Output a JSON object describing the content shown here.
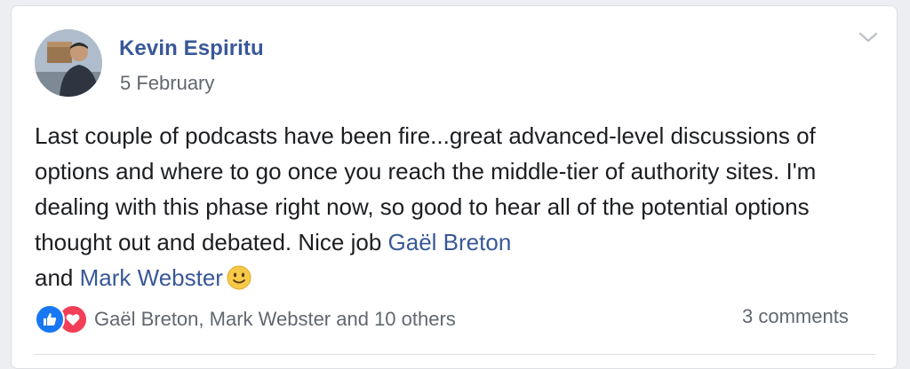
{
  "post": {
    "author": "Kevin Espiritu",
    "date": "5 February",
    "text_before": "Last couple of podcasts have been fire...great advanced-level discussions of options and where to go once you reach the middle-tier of authority sites. I'm dealing with this phase right now, so good to hear all of the potential options thought out and debated. Nice job ",
    "mention_1": "Gaël Breton",
    "text_between": "and",
    "mention_2": "Mark Webster",
    "emoji_icon": "slightly-smiling-face-icon"
  },
  "footer": {
    "reaction_icons": [
      "like-icon",
      "love-icon"
    ],
    "reactions_text": "Gaël Breton, Mark Webster and 10 others",
    "comments_count": "3 comments"
  },
  "colors": {
    "link": "#385898",
    "text": "#1c1e21",
    "muted": "#616770",
    "like": "#1877f2",
    "love": "#f33e58"
  }
}
